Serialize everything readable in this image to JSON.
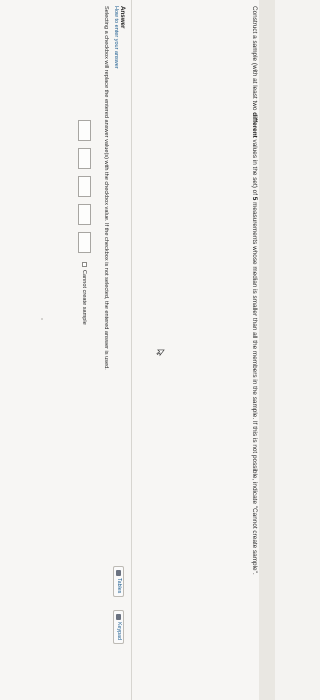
{
  "question": {
    "part1": "Construct a sample (with at least two ",
    "emph": "different",
    "part2": " values in the set) of ",
    "num": "5",
    "part3": " measurements whose median is smaller than all the members in the sample. If this is not possible, indicate \"Cannot create sample\"."
  },
  "toolbar": {
    "tables_label": "Tables",
    "keypad_label": "Keypad"
  },
  "answer": {
    "title": "Answer",
    "how_to": "How to enter your answer",
    "instruction": "Selecting a checkbox will replace the entered answer value(s) with the checkbox value. If the checkbox is not selected, the entered answer is used.",
    "inputs": [
      "",
      "",
      "",
      "",
      ""
    ],
    "cannot_create_label": "Cannot create sample",
    "cannot_create_checked": false
  },
  "icons": {
    "tables": "table-icon",
    "keypad": "keypad-icon",
    "pointer": "mouse-pointer-icon"
  }
}
